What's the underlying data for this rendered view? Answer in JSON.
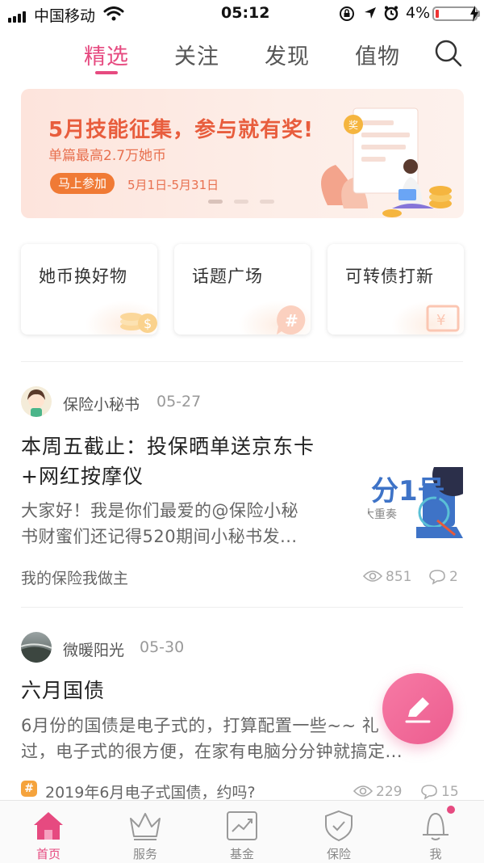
{
  "status_bar": {
    "carrier": "中国移动",
    "time": "05:12",
    "battery": "4%"
  },
  "top_tabs": [
    {
      "label": "精选",
      "active": true
    },
    {
      "label": "关注",
      "active": false
    },
    {
      "label": "发现",
      "active": false
    },
    {
      "label": "值物",
      "active": false
    }
  ],
  "banner": {
    "title": "5月技能征集，参与就有奖!",
    "subtitle": "单篇最高2.7万她币",
    "button": "马上参加",
    "date_range": "5月1日-5月31日",
    "badge": "奖"
  },
  "quick_cards": [
    {
      "label": "她币换好物",
      "icon": "coin-stack-icon"
    },
    {
      "label": "话题广场",
      "icon": "hashtag-bubble-icon"
    },
    {
      "label": "可转债打新",
      "icon": "yen-ticket-icon"
    }
  ],
  "posts": [
    {
      "author": "保险小秘书",
      "date": "05-27",
      "title_lines": [
        "本周五截止：投保晒单送京东卡",
        "+网红按摩仪"
      ],
      "summary_lines": [
        "大家好！我是你们最爱的@保险小秘",
        "书财蜜们还记得520期间小秘书发..."
      ],
      "tag": "我的保险我做主",
      "views": "851",
      "comments": "2",
      "thumb_text": "分1号",
      "thumb_sub": "大重奏"
    },
    {
      "author": "微暖阳光",
      "date": "05-30",
      "title_lines": [
        "六月国债"
      ],
      "summary_lines": [
        "6月份的国债是电子式的，打算配置一些~~  礼",
        "过，电子式的很方便，在家有电脑分分钟就搞定..."
      ],
      "tag": "2019年6月电子式国债，约吗?",
      "tag_badge": "#",
      "views": "229",
      "comments": "15"
    }
  ],
  "bottom_nav": [
    {
      "label": "首页",
      "icon": "home-icon",
      "active": true
    },
    {
      "label": "服务",
      "icon": "crown-icon",
      "active": false
    },
    {
      "label": "基金",
      "icon": "chart-icon",
      "active": false
    },
    {
      "label": "保险",
      "icon": "shield-check-icon",
      "active": false
    },
    {
      "label": "我",
      "icon": "user-icon",
      "active": false,
      "badge_dot": true
    }
  ],
  "colors": {
    "accent": "#e64a80",
    "banner_orange": "#e85d3d",
    "button_orange": "#f07a35",
    "fab_pink": "#ec5d8f"
  }
}
